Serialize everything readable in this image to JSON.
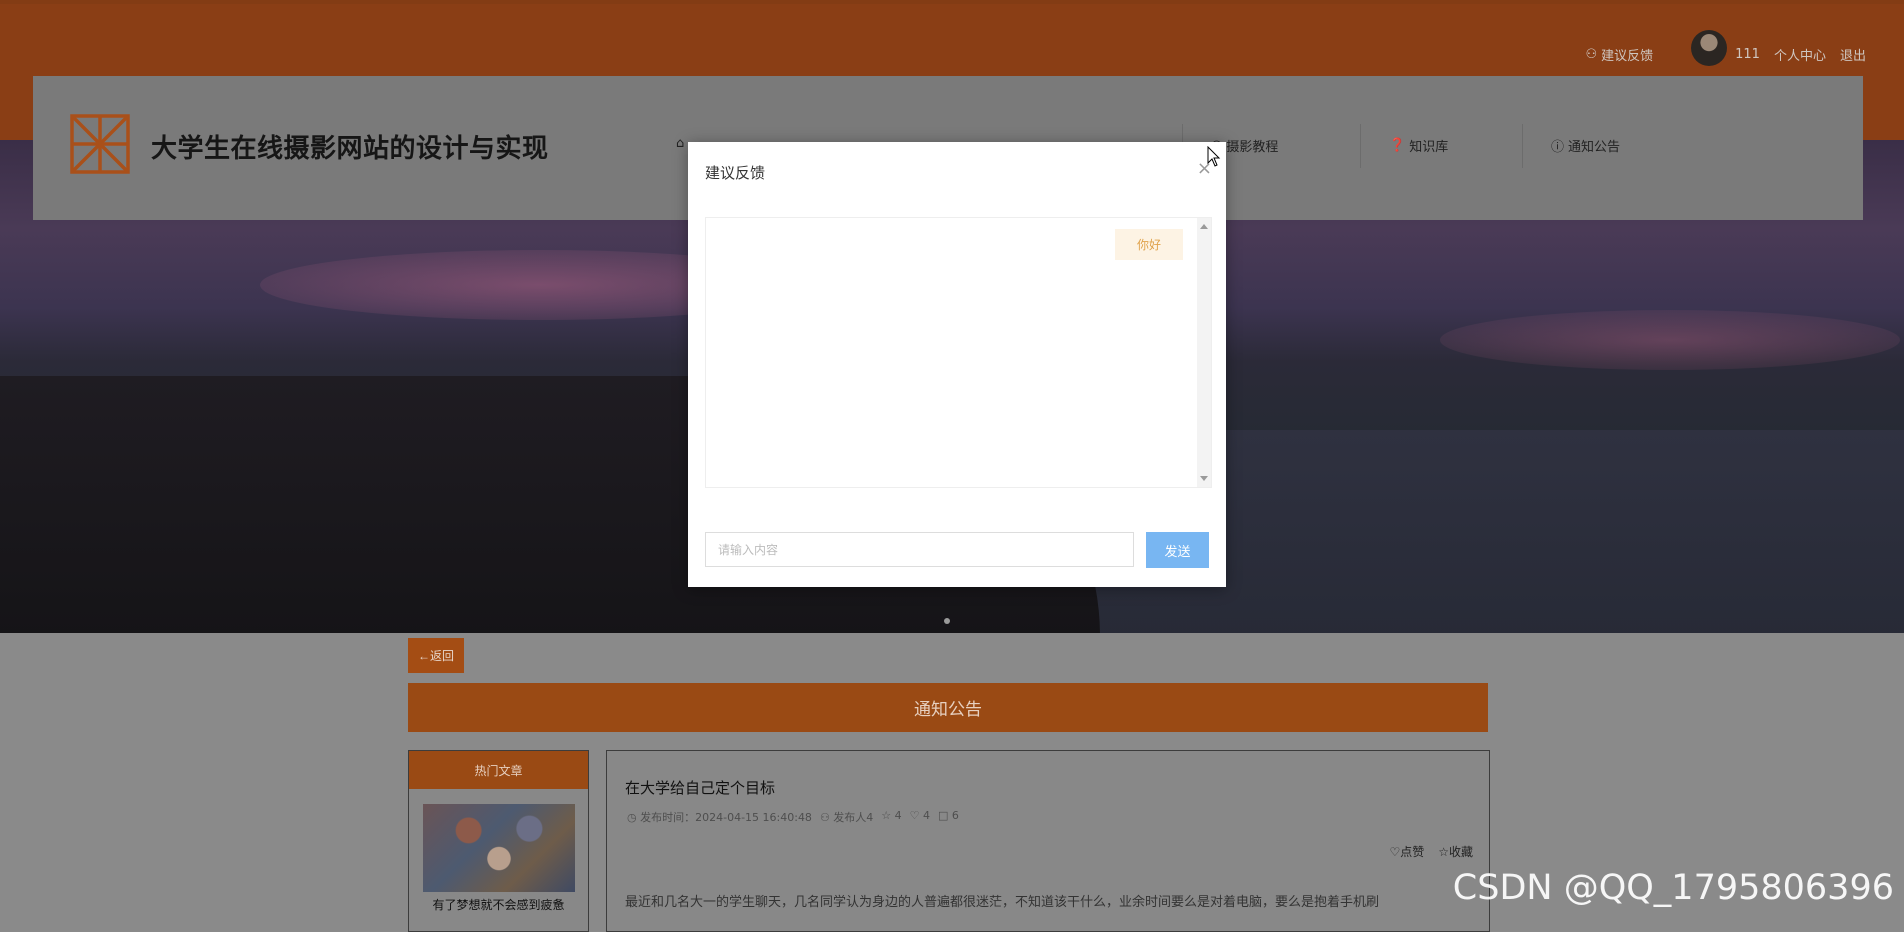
{
  "user_nav": {
    "feedback": "建议反馈",
    "username": "111",
    "personal_center": "个人中心",
    "logout": "退出"
  },
  "header": {
    "site_title": "大学生在线摄影网站的设计与实现",
    "nav": [
      {
        "label": "",
        "icon": "home-icon"
      },
      {
        "label": "摄影教程",
        "icon": "camera-icon"
      },
      {
        "label": "知识库",
        "icon": "question-circle-icon"
      },
      {
        "label": "通知公告",
        "icon": "info-circle-icon"
      }
    ]
  },
  "content": {
    "back_label": "←返回",
    "section_title": "通知公告",
    "hot": {
      "heading": "热门文章",
      "item_title": "有了梦想就不会感到疲惫"
    },
    "article": {
      "title": "在大学给自己定个目标",
      "meta": {
        "publish": "发布时间：2024-04-15 16:40:48",
        "author": "发布人4",
        "likes": "4",
        "favorites": "4",
        "comments": "6"
      },
      "like_label": "点赞",
      "favorite_label": "收藏",
      "body": "最近和几名大一的学生聊天，几名同学认为身边的人普遍都很迷茫，不知道该干什么，业余时间要么是对着电脑，要么是抱着手机刷"
    }
  },
  "modal": {
    "title": "建议反馈",
    "messages": [
      "你好"
    ],
    "input_placeholder": "请输入内容",
    "send_label": "发送"
  },
  "watermark": "CSDN @QQ_1795806396",
  "colors": {
    "brand_orange": "#c0591a",
    "send_button": "#78b6f2",
    "bubble_bg": "#fdf3e4",
    "bubble_text": "#e0a24b"
  }
}
